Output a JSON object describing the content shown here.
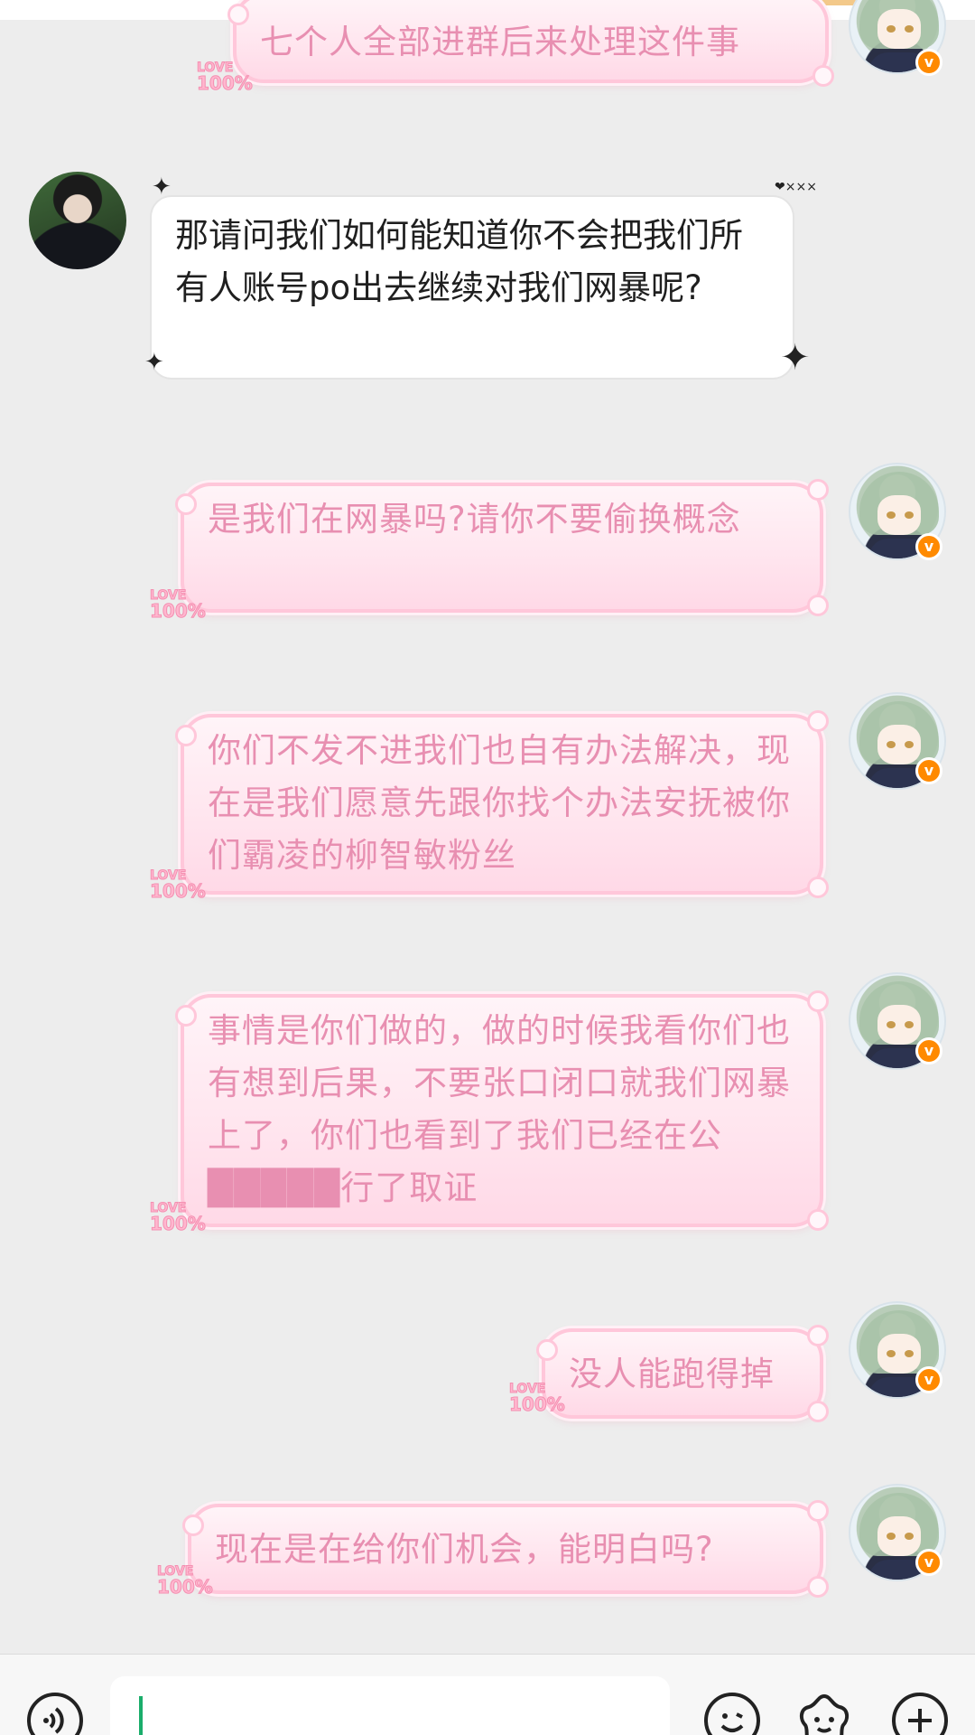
{
  "chat": {
    "messages": [
      {
        "sender": "self",
        "text": "七个人全部进群后来处理这件事"
      },
      {
        "sender": "other",
        "text": "那请问我们如何能知道你不会把我们所有人账号po出去继续对我们网暴呢?"
      },
      {
        "sender": "self",
        "text": "是我们在网暴吗?请你不要偷换概念"
      },
      {
        "sender": "self",
        "text": "你们不发不进我们也自有办法解决，现在是我们愿意先跟你找个办法安抚被你们霸凌的柳智敏粉丝"
      },
      {
        "sender": "self",
        "text": "事情是你们做的，做的时候我看你们也有想到后果，不要张口闭口就我们网暴上了，你们也看到了我们已经在公█████行了取证"
      },
      {
        "sender": "self",
        "text": "没人能跑得掉"
      },
      {
        "sender": "self",
        "text": "现在是在给你们机会，能明白吗?"
      }
    ]
  },
  "decor": {
    "love_tag_top": "LOVE",
    "love_tag_bottom": "100%",
    "verified_badge": "v",
    "sparkle_symbol": "✦",
    "hearts_label": "❤×××"
  },
  "input_bar": {
    "input_value": "",
    "icons": [
      "voice-icon",
      "emoji-icon",
      "sticker-icon",
      "plus-icon"
    ]
  },
  "colors": {
    "background": "#ededed",
    "pink_text": "#e88fb1",
    "pink_border": "#ffc7da",
    "badge": "#ff8a00",
    "caret": "#1aad6b"
  }
}
